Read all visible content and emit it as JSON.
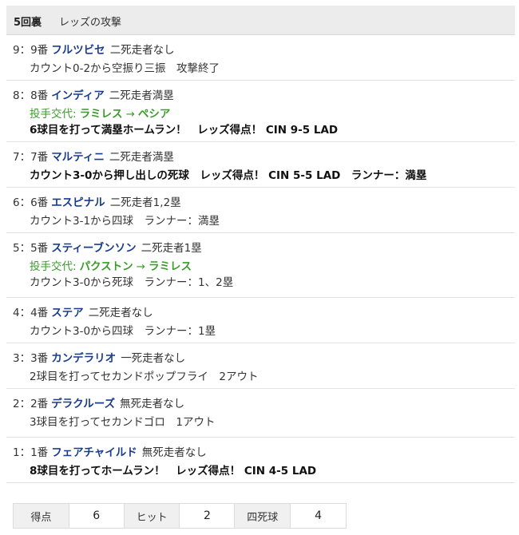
{
  "header": {
    "inning": "5回裏",
    "attack": "レッズの攻撃"
  },
  "plate_appearances": [
    {
      "order": "9：9番",
      "batter": "フルツビセ",
      "situation": "二死走者なし",
      "lines": [
        {
          "kind": "normal",
          "text": "カウント0-2から空振り三振　攻撃終了"
        }
      ]
    },
    {
      "order": "8：8番",
      "batter": "インディア",
      "situation": "二死走者満塁",
      "pitch_change": {
        "label": "投手交代:",
        "from": "ラミレス",
        "arrow": "→",
        "to": "ペシア"
      },
      "lines": [
        {
          "kind": "bold",
          "text": "6球目を打って満塁ホームラン！　レッズ得点！ CIN 9-5 LAD"
        }
      ]
    },
    {
      "order": "7：7番",
      "batter": "マルティニ",
      "situation": "二死走者満塁",
      "lines": [
        {
          "kind": "bold",
          "text": "カウント3-0から押し出しの死球　レッズ得点！ CIN 5-5 LAD　ランナー：満塁"
        }
      ]
    },
    {
      "order": "6：6番",
      "batter": "エスピナル",
      "situation": "二死走者1,2塁",
      "lines": [
        {
          "kind": "normal",
          "text": "カウント3-1から四球　ランナー：満塁"
        }
      ]
    },
    {
      "order": "5：5番",
      "batter": "スティーブンソン",
      "situation": "二死走者1塁",
      "pitch_change": {
        "label": "投手交代:",
        "from": "パクストン",
        "arrow": "→",
        "to": "ラミレス"
      },
      "lines": [
        {
          "kind": "normal",
          "text": "カウント3-0から死球　ランナー：1、2塁"
        }
      ]
    },
    {
      "order": "4：4番",
      "batter": "ステア",
      "situation": "二死走者なし",
      "lines": [
        {
          "kind": "normal",
          "text": "カウント3-0から四球　ランナー：1塁"
        }
      ]
    },
    {
      "order": "3：3番",
      "batter": "カンデラリオ",
      "situation": "一死走者なし",
      "lines": [
        {
          "kind": "normal",
          "text": "2球目を打ってセカンドポップフライ　2アウト"
        }
      ]
    },
    {
      "order": "2：2番",
      "batter": "デラクルーズ",
      "situation": "無死走者なし",
      "lines": [
        {
          "kind": "normal",
          "text": "3球目を打ってセカンドゴロ　1アウト"
        }
      ]
    },
    {
      "order": "1：1番",
      "batter": "フェアチャイルド",
      "situation": "無死走者なし",
      "lines": [
        {
          "kind": "bold",
          "text": "8球目を打ってホームラン！　レッズ得点！ CIN 4-5 LAD"
        }
      ]
    }
  ],
  "summary": {
    "runs_label": "得点",
    "runs": "6",
    "hits_label": "ヒット",
    "hits": "2",
    "walks_label": "四死球",
    "walks": "4"
  }
}
